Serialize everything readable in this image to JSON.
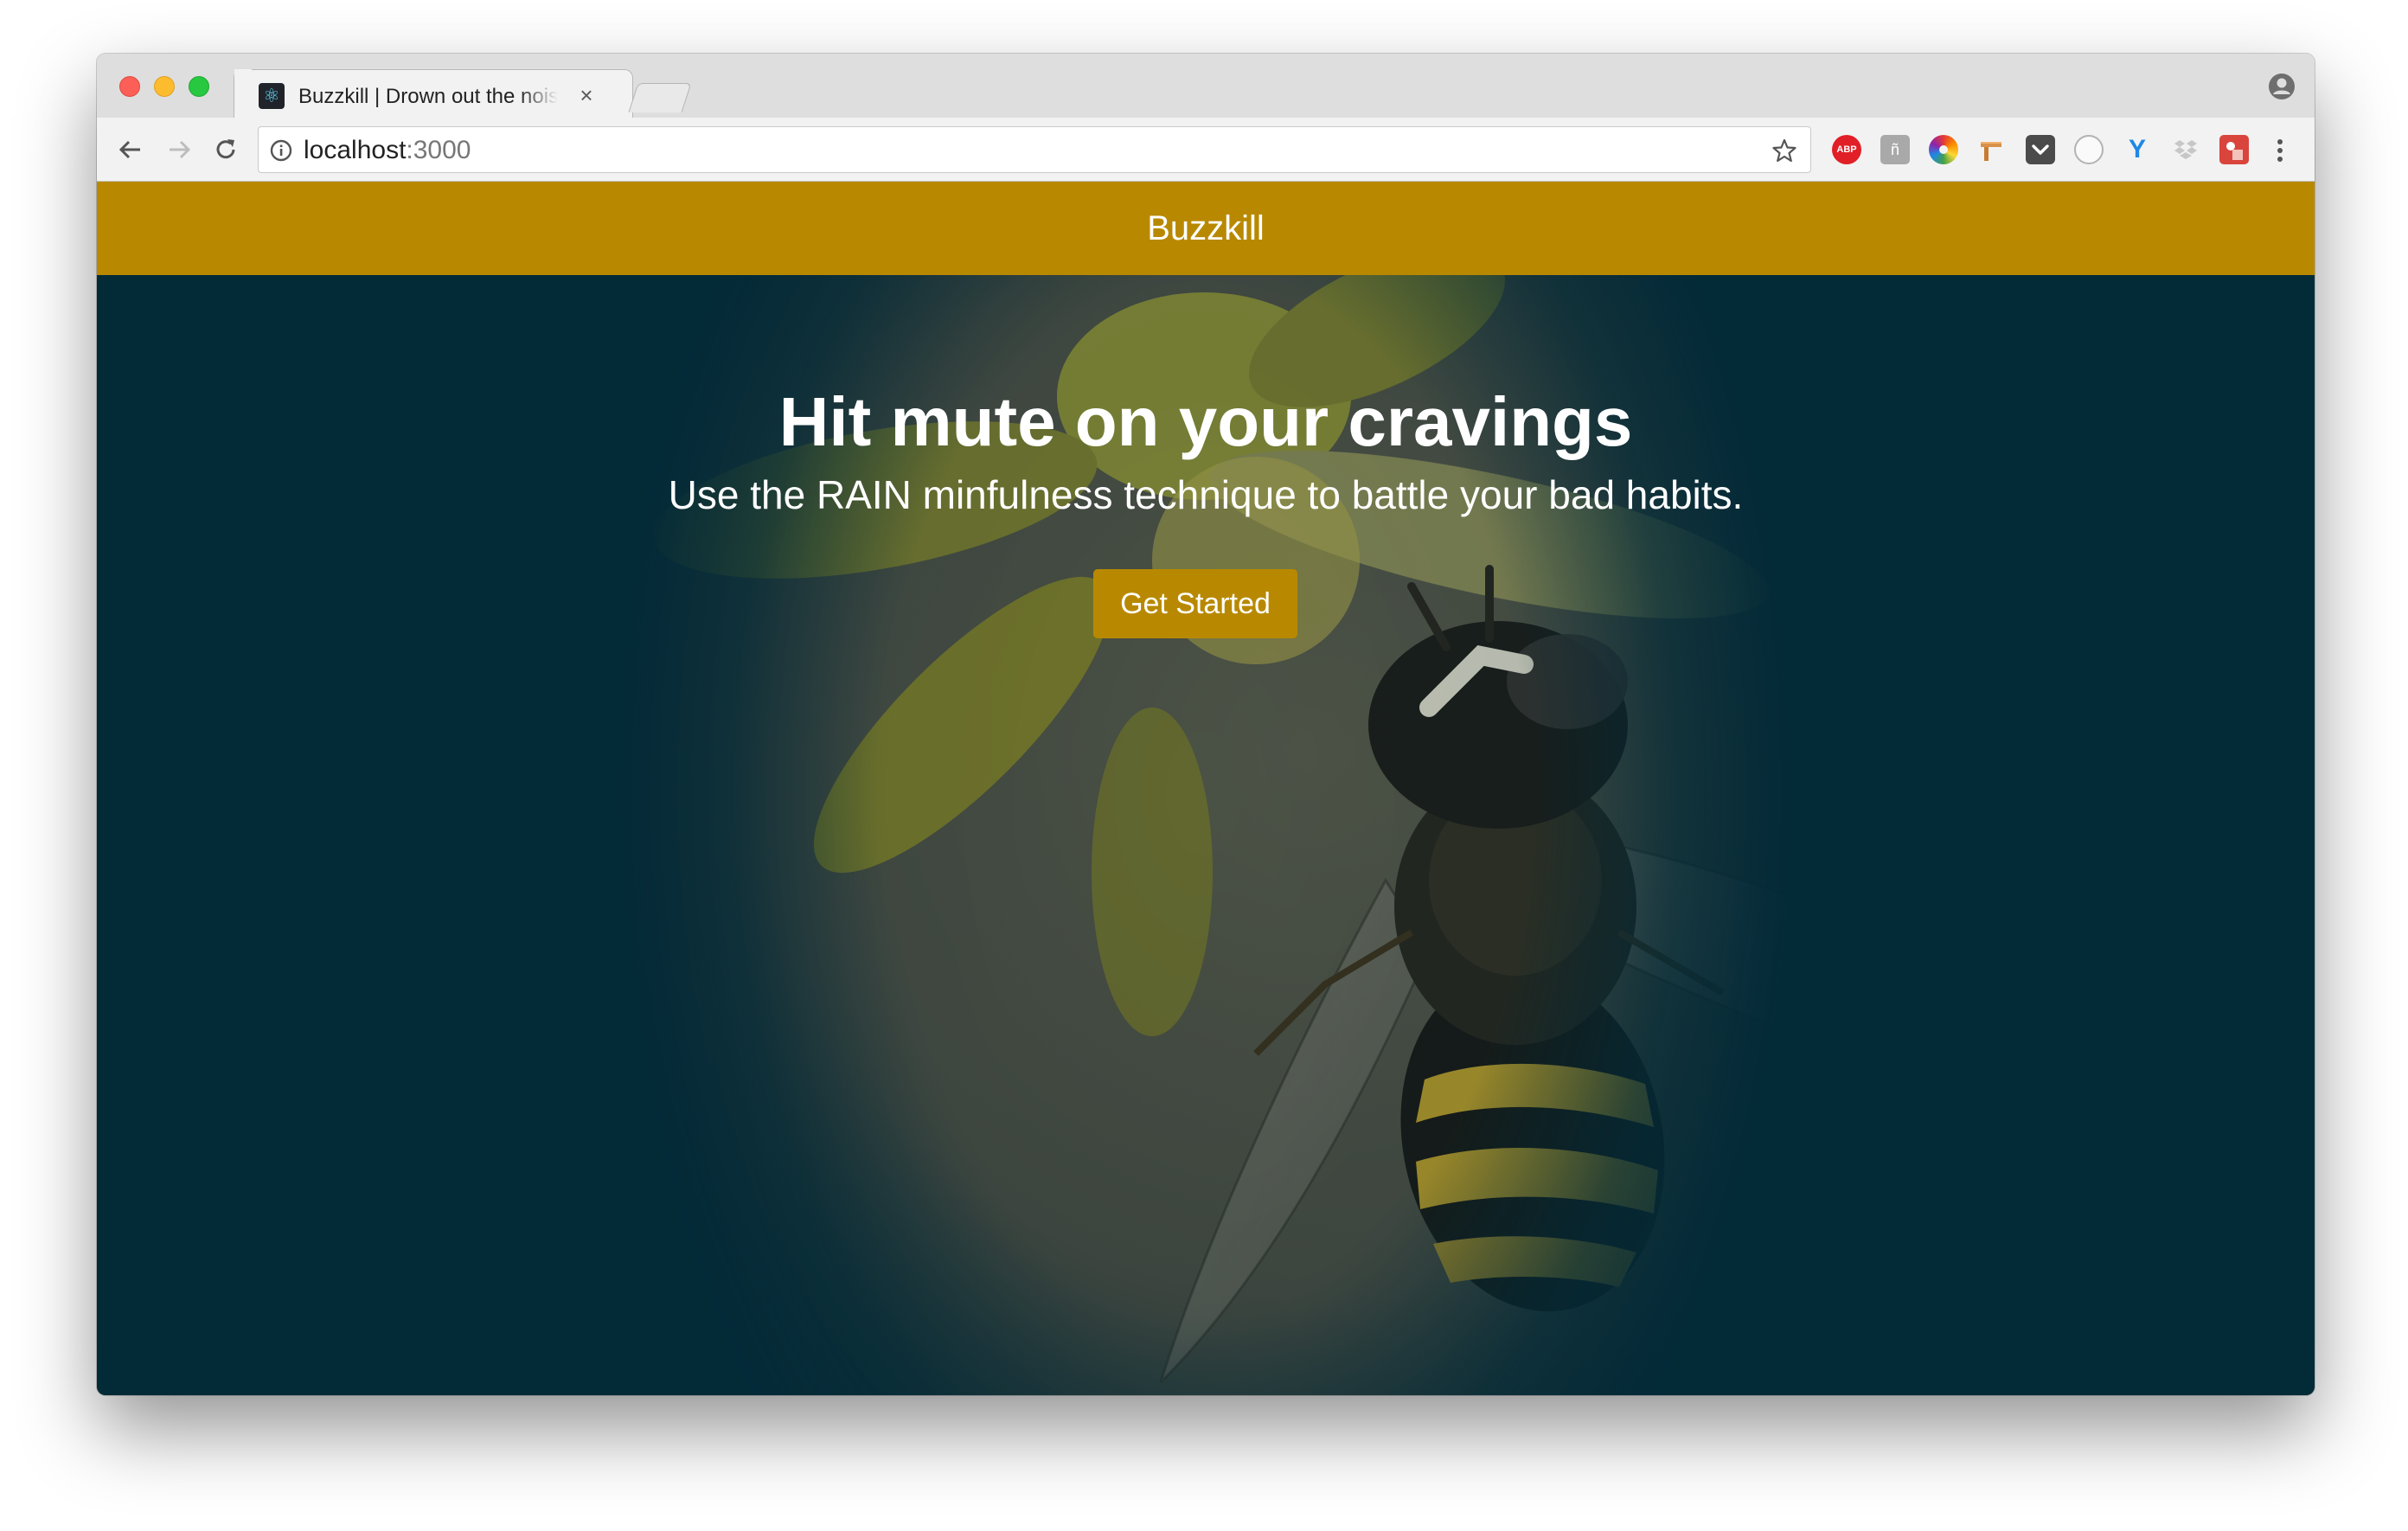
{
  "browser": {
    "tab": {
      "title": "Buzzkill | Drown out the noise",
      "favicon": "react-icon"
    },
    "address_bar": {
      "host": "localhost",
      "port": ":3000"
    },
    "extensions": [
      "adblock-plus-icon",
      "grey-extension-icon",
      "color-wheel-icon",
      "wood-extension-icon",
      "pocket-icon",
      "circle-extension-icon",
      "y-extension-icon",
      "dropbox-icon",
      "red-extension-icon"
    ],
    "extension_labels": {
      "adblock": "ABP"
    }
  },
  "app": {
    "brand": "Buzzkill",
    "accent_color": "#b88900",
    "hero_overlay_color": "#022a3a"
  },
  "hero": {
    "title": "Hit mute on your cravings",
    "subtitle": "Use the RAIN minfulness technique to battle your bad habits.",
    "cta_label": "Get Started"
  }
}
